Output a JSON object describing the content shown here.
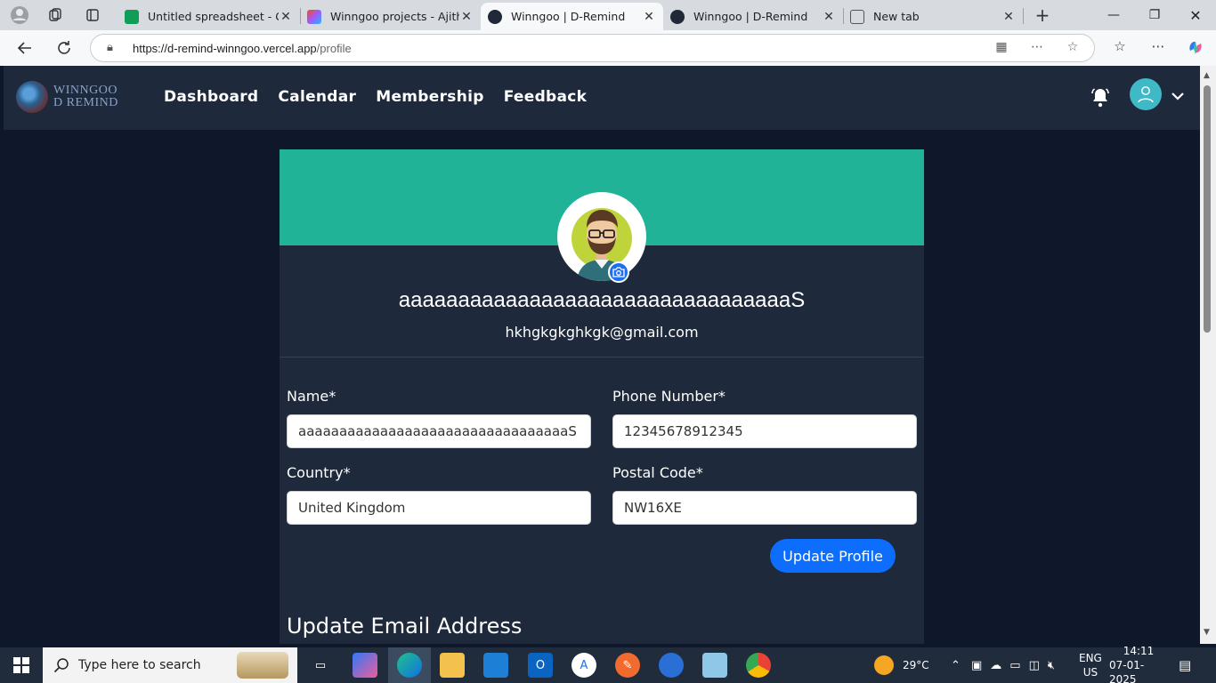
{
  "browser": {
    "tabs": [
      {
        "title": "Untitled spreadsheet - Goo",
        "color": "#0f9d58",
        "active": false
      },
      {
        "title": "Winngoo projects - Ajith D",
        "color": "#e34c26",
        "active": false
      },
      {
        "title": "Winngoo | D-Remind",
        "color": "#1f2937",
        "active": true
      },
      {
        "title": "Winngoo | D-Remind",
        "color": "#1f2937",
        "active": false
      },
      {
        "title": "New tab",
        "color": "#666666",
        "active": false
      }
    ],
    "url_host": "https://d-remind-winngoo.vercel.app",
    "url_path": "/profile"
  },
  "app": {
    "logo_line1": "WINNGOO",
    "logo_line2": "D REMIND",
    "nav": [
      "Dashboard",
      "Calendar",
      "Membership",
      "Feedback"
    ]
  },
  "profile": {
    "name": "aaaaaaaaaaaaaaaaaaaaaaaaaaaaaaaaaS",
    "email": "hkhgkgkghkgk@gmail.com",
    "banner_color": "#20b397"
  },
  "form": {
    "name_label": "Name*",
    "name_value": "aaaaaaaaaaaaaaaaaaaaaaaaaaaaaaaaaS",
    "phone_label": "Phone Number*",
    "phone_value": "12345678912345",
    "country_label": "Country*",
    "country_value": "United Kingdom",
    "postal_label": "Postal Code*",
    "postal_value": "NW16XE",
    "submit_label": "Update Profile"
  },
  "email_section_title": "Update Email Address",
  "taskbar": {
    "search_placeholder": "Type here to search",
    "weather": "29°C",
    "lang1": "ENG",
    "lang2": "US",
    "time": "14:11",
    "date": "07-01-2025"
  }
}
